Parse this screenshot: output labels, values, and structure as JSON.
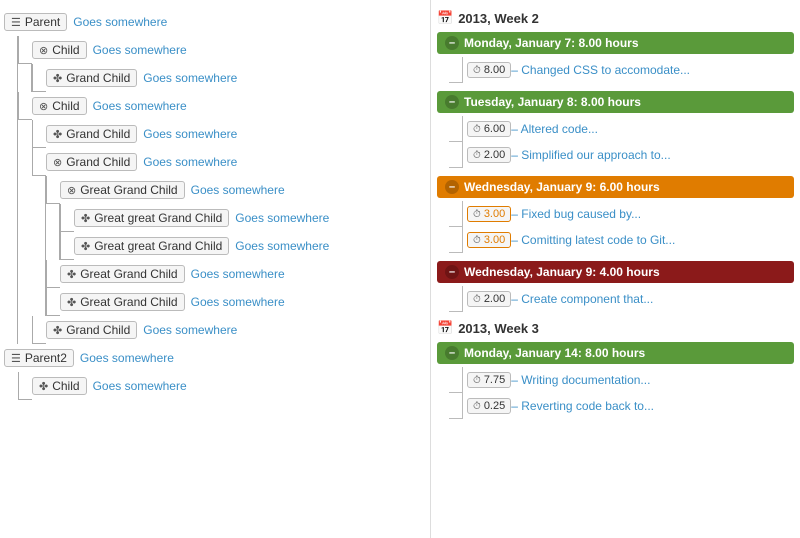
{
  "tree": {
    "nodes": [
      {
        "id": "parent1",
        "icon": "folder",
        "label": "Parent",
        "link": "Goes somewhere",
        "level": 0,
        "children": [
          {
            "id": "child1",
            "icon": "minus-circle",
            "label": "Child",
            "link": "Goes somewhere",
            "level": 1,
            "children": [
              {
                "id": "grandchild1",
                "icon": "leaf",
                "label": "Grand Child",
                "link": "Goes somewhere",
                "level": 2,
                "children": []
              }
            ]
          },
          {
            "id": "child2",
            "icon": "minus-circle",
            "label": "Child",
            "link": "Goes somewhere",
            "level": 1,
            "children": [
              {
                "id": "grandchild2",
                "icon": "leaf",
                "label": "Grand Child",
                "link": "Goes somewhere",
                "level": 2,
                "children": []
              },
              {
                "id": "grandchild3",
                "icon": "minus-circle",
                "label": "Grand Child",
                "link": "Goes somewhere",
                "level": 2,
                "children": [
                  {
                    "id": "greatgrand1",
                    "icon": "minus-circle",
                    "label": "Great Grand Child",
                    "link": "Goes somewhere",
                    "level": 3,
                    "children": [
                      {
                        "id": "ggrand1",
                        "icon": "leaf",
                        "label": "Great great Grand Child",
                        "link": "Goes somewhere",
                        "level": 4,
                        "children": []
                      },
                      {
                        "id": "ggrand2",
                        "icon": "leaf",
                        "label": "Great great Grand Child",
                        "link": "Goes somewhere",
                        "level": 4,
                        "children": []
                      }
                    ]
                  },
                  {
                    "id": "greatgrand2",
                    "icon": "leaf",
                    "label": "Great Grand Child",
                    "link": "Goes somewhere",
                    "level": 3,
                    "children": []
                  },
                  {
                    "id": "greatgrand3",
                    "icon": "leaf",
                    "label": "Great Grand Child",
                    "link": "Goes somewhere",
                    "level": 3,
                    "children": []
                  }
                ]
              },
              {
                "id": "grandchild4",
                "icon": "leaf",
                "label": "Grand Child",
                "link": "Goes somewhere",
                "level": 2,
                "children": []
              }
            ]
          }
        ]
      },
      {
        "id": "parent2",
        "icon": "folder",
        "label": "Parent2",
        "link": "Goes somewhere",
        "level": 0,
        "children": [
          {
            "id": "child3",
            "icon": "leaf",
            "label": "Child",
            "link": "Goes somewhere",
            "level": 1,
            "children": []
          }
        ]
      }
    ]
  },
  "timeline": {
    "weeks": [
      {
        "id": "week1",
        "label": "2013, Week 2",
        "days": [
          {
            "id": "day1",
            "label": "Monday, January 7: 8.00 hours",
            "color": "green",
            "entries": [
              {
                "id": "e1",
                "time": "8.00",
                "highlight": false,
                "desc": "– Changed CSS to accomodate..."
              }
            ]
          },
          {
            "id": "day2",
            "label": "Tuesday, January 8: 8.00 hours",
            "color": "green",
            "entries": [
              {
                "id": "e2",
                "time": "6.00",
                "highlight": false,
                "desc": "– Altered code..."
              },
              {
                "id": "e3",
                "time": "2.00",
                "highlight": false,
                "desc": "– Simplified our approach to..."
              }
            ]
          },
          {
            "id": "day3",
            "label": "Wednesday, January 9: 6.00 hours",
            "color": "orange",
            "entries": [
              {
                "id": "e4",
                "time": "3.00",
                "highlight": true,
                "desc": "– Fixed bug caused by..."
              },
              {
                "id": "e5",
                "time": "3.00",
                "highlight": true,
                "desc": "– Comitting latest code to Git..."
              }
            ]
          },
          {
            "id": "day4",
            "label": "Wednesday, January 9: 4.00 hours",
            "color": "dark-red",
            "entries": [
              {
                "id": "e6",
                "time": "2.00",
                "highlight": false,
                "desc": "– Create component that..."
              }
            ]
          }
        ]
      },
      {
        "id": "week2",
        "label": "2013, Week 3",
        "days": [
          {
            "id": "day5",
            "label": "Monday, January 14: 8.00 hours",
            "color": "green",
            "entries": [
              {
                "id": "e7",
                "time": "7.75",
                "highlight": false,
                "desc": "– Writing documentation..."
              },
              {
                "id": "e8",
                "time": "0.25",
                "highlight": false,
                "desc": "– Reverting code back to..."
              }
            ]
          }
        ]
      }
    ]
  },
  "icons": {
    "folder": "📁",
    "leaf": "🍃",
    "minus_circle": "⊖",
    "clock": "🕐",
    "calendar": "📅"
  }
}
